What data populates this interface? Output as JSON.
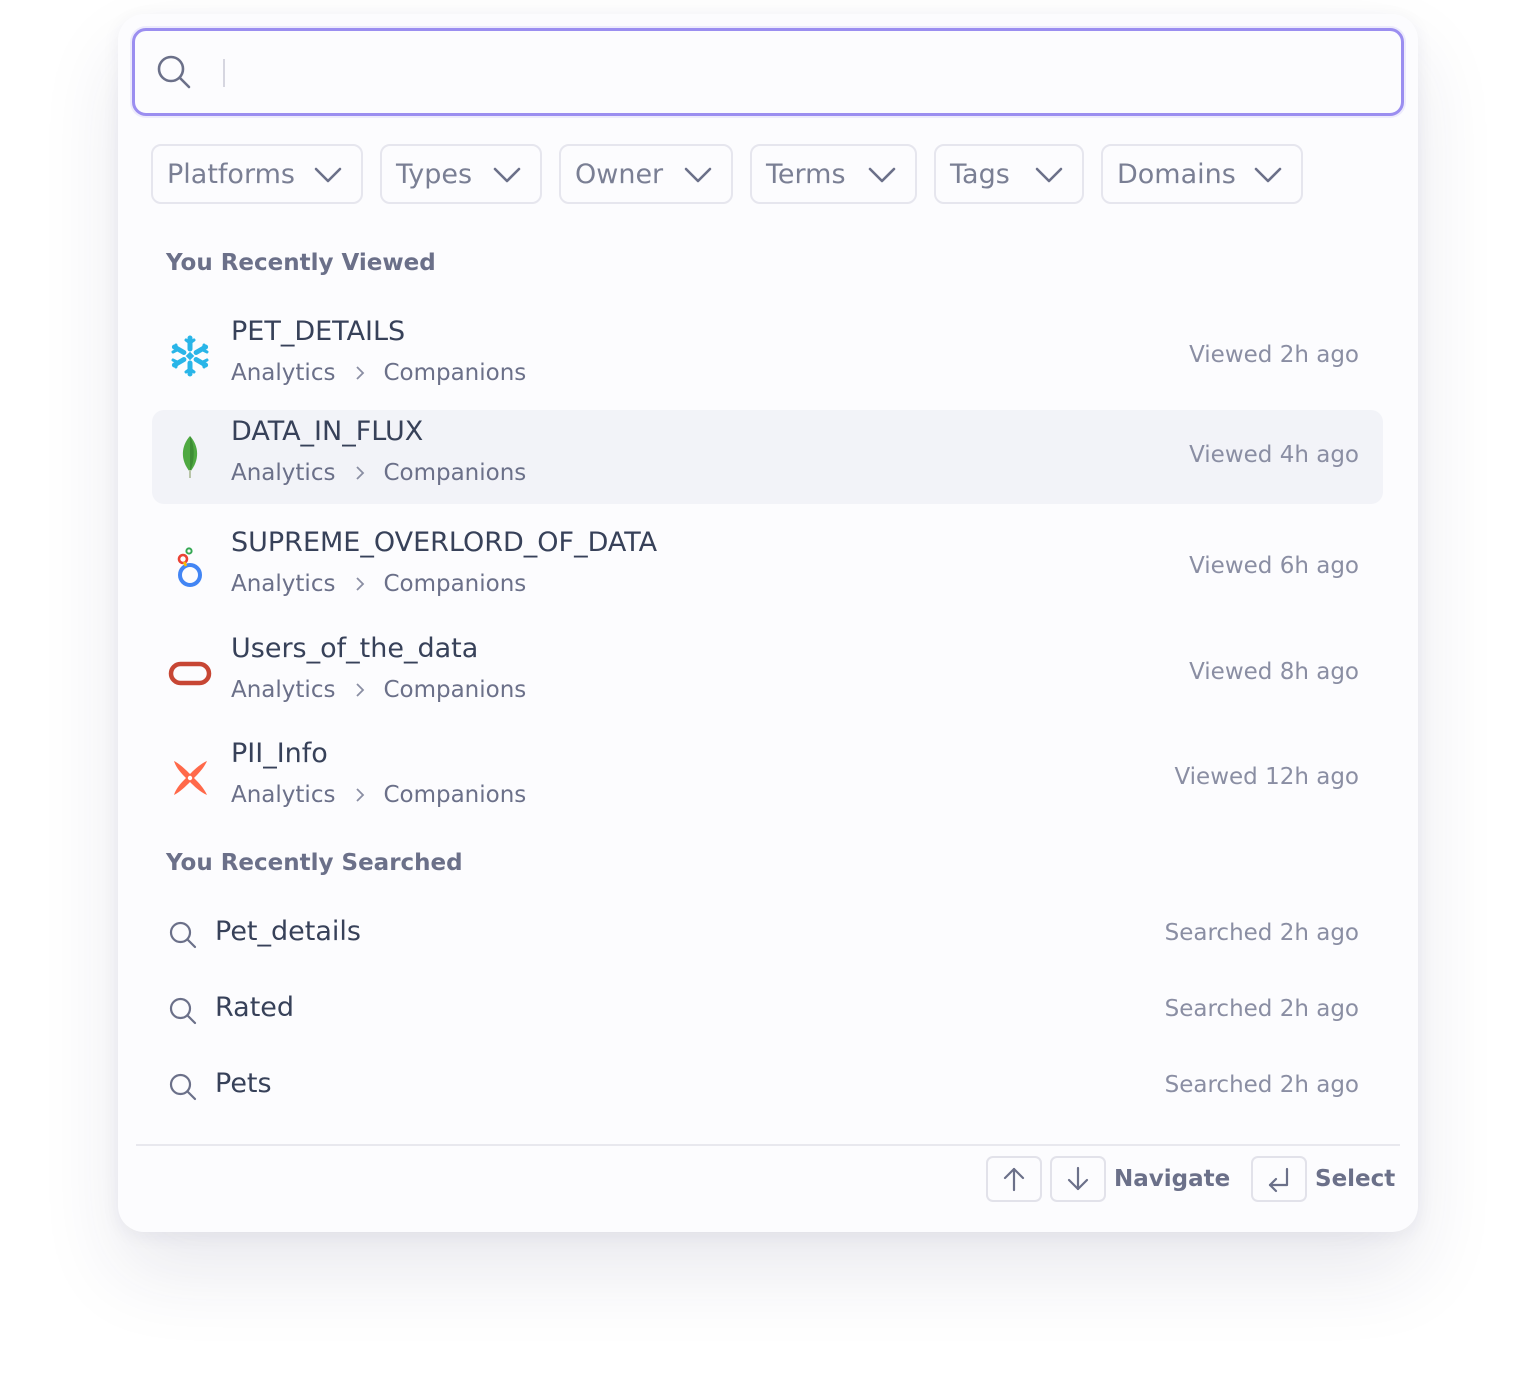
{
  "search": {
    "value": "",
    "placeholder": ""
  },
  "filters": [
    "Platforms",
    "Types",
    "Owner",
    "Terms",
    "Tags",
    "Domains"
  ],
  "recently_viewed": {
    "title": "You Recently Viewed",
    "items": [
      {
        "name": "PET_DETAILS",
        "path": [
          "Analytics",
          "Companions"
        ],
        "time": "Viewed 2h ago",
        "logo": "snowflake-icon"
      },
      {
        "name": "DATA_IN_FLUX",
        "path": [
          "Analytics",
          "Companions"
        ],
        "time": "Viewed 4h ago",
        "logo": "mongodb-leaf-icon"
      },
      {
        "name": "SUPREME_OVERLORD_OF_DATA",
        "path": [
          "Analytics",
          "Companions"
        ],
        "time": "Viewed 6h ago",
        "logo": "looker-icon"
      },
      {
        "name": "Users_of_the_data",
        "path": [
          "Analytics",
          "Companions"
        ],
        "time": "Viewed 8h ago",
        "logo": "oracle-icon"
      },
      {
        "name": "PII_Info",
        "path": [
          "Analytics",
          "Companions"
        ],
        "time": "Viewed 12h ago",
        "logo": "dbt-icon"
      }
    ]
  },
  "recently_searched": {
    "title": "You Recently Searched",
    "items": [
      {
        "query": "Pet_details",
        "time": "Searched 2h ago"
      },
      {
        "query": "Rated",
        "time": "Searched 2h ago"
      },
      {
        "query": "Pets",
        "time": "Searched 2h ago"
      }
    ]
  },
  "footer": {
    "navigate_label": "Navigate",
    "select_label": "Select"
  },
  "colors": {
    "accent": "#9b8ef0",
    "highlight_row": "#f2f3f8",
    "text_primary": "#374159",
    "text_muted": "#6b7089"
  }
}
